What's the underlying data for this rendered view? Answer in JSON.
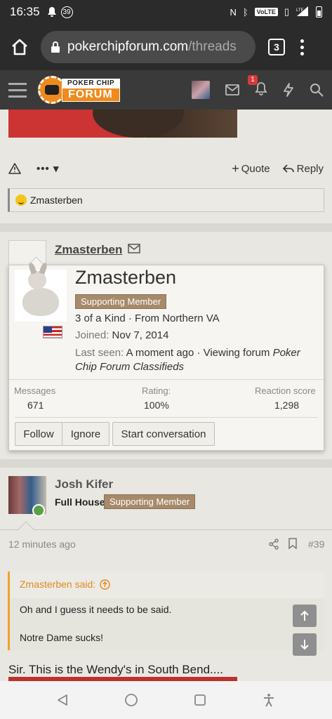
{
  "status_bar": {
    "time": "16:35",
    "notif_count": "39",
    "volte": "VoLTE",
    "lte": "LTE"
  },
  "browser": {
    "url_domain": "pokerchipforum.com",
    "url_path": "/threads",
    "tab_count": "3"
  },
  "site_header": {
    "logo_top": "POKER CHIP",
    "logo_bottom": "FORUM",
    "alert_count": "1"
  },
  "post1": {
    "more_label": "•••",
    "quote_label": "Quote",
    "reply_label": "Reply",
    "reaction_user": "Zmasterben"
  },
  "post2": {
    "author": "Zmasterben"
  },
  "member_card": {
    "name": "Zmasterben",
    "tag": "Supporting Member",
    "title_line": "3 of a Kind · From Northern VA",
    "joined_label": "Joined:",
    "joined_value": "Nov 7, 2014",
    "last_seen_label": "Last seen:",
    "last_seen_value": "A moment ago · Viewing forum",
    "last_seen_forum_1": "Poker",
    "last_seen_forum_2": "Chip Forum Classifieds",
    "stats": [
      {
        "label": "Messages",
        "value": "671"
      },
      {
        "label": "Rating:",
        "value": "100%"
      },
      {
        "label": "Reaction score",
        "value": "1,298"
      }
    ],
    "buttons": {
      "follow": "Follow",
      "ignore": "Ignore",
      "start_conversation": "Start conversation"
    }
  },
  "post3": {
    "author": "Josh Kifer",
    "user_title": "Full House",
    "tag": "Supporting Member",
    "time": "12 minutes ago",
    "post_number": "#39",
    "quote_author": "Zmasterben said:",
    "quote_line1": "Oh and I guess it needs to be said.",
    "quote_line2": "Notre Dame sucks!",
    "text": "Sir. This is the Wendy's in South Bend...."
  },
  "colors": {
    "accent_orange": "#f08a1c",
    "tag_bg": "#a68a6a",
    "alert_red": "#d63a3a",
    "online_green": "#5aa04a"
  }
}
